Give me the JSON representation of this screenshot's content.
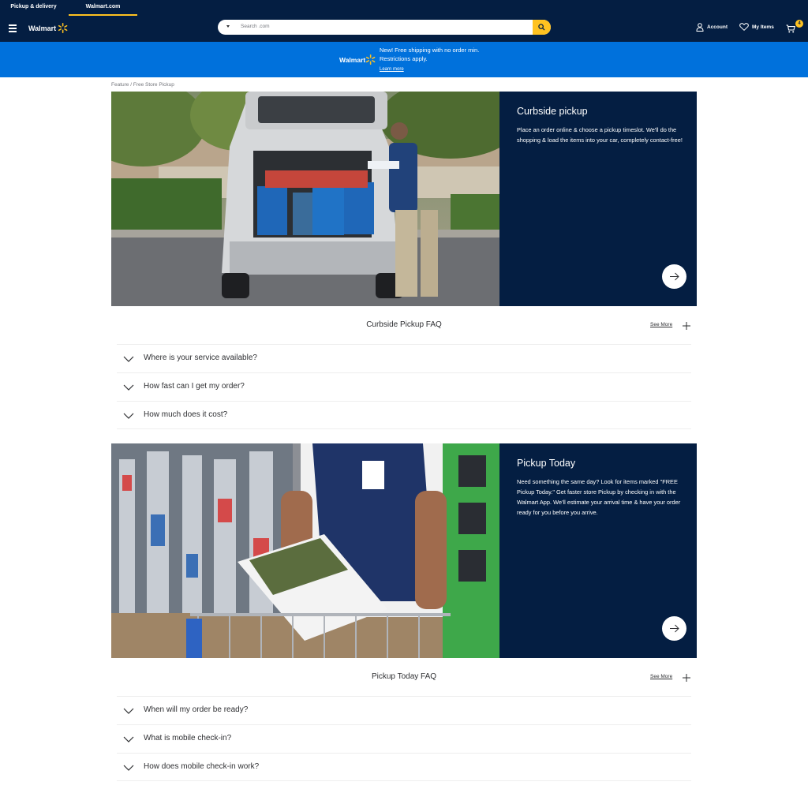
{
  "top_tabs": [
    "Pickup & delivery",
    "Walmart.com"
  ],
  "header": {
    "logo_text": "Walmart",
    "search_placeholder": "Search .com",
    "account_label": "Account",
    "my_items_label": "My Items",
    "cart_count": "4"
  },
  "promo": {
    "logo_text": "Walmart",
    "message": "New! Free shipping with no order min. Restrictions apply.",
    "link": "Learn more"
  },
  "breadcrumb": "Feature / Free Store Pickup",
  "sections": [
    {
      "title": "Curbside pickup",
      "description": "Place an order online & choose a pickup timeslot. We'll do the shopping & load the items into your car, completely contact-free!",
      "faq_title": "Curbside Pickup FAQ",
      "see_more": "See More",
      "faqs": [
        "Where is your service available?",
        "How fast can I get my order?",
        "How much does it cost?"
      ]
    },
    {
      "title": "Pickup Today",
      "description": "Need something the same day? Look for items marked \"FREE Pickup Today.\" Get faster store Pickup by checking in with the Walmart App. We'll estimate your arrival time & have your order ready for you before you arrive.",
      "faq_title": "Pickup Today FAQ",
      "see_more": "See More",
      "faqs": [
        "When will my order be ready?",
        "What is mobile check-in?",
        "How does mobile check-in work?"
      ]
    }
  ],
  "colors": {
    "navy": "#041e42",
    "blue": "#0071dc",
    "yellow": "#ffc220"
  }
}
